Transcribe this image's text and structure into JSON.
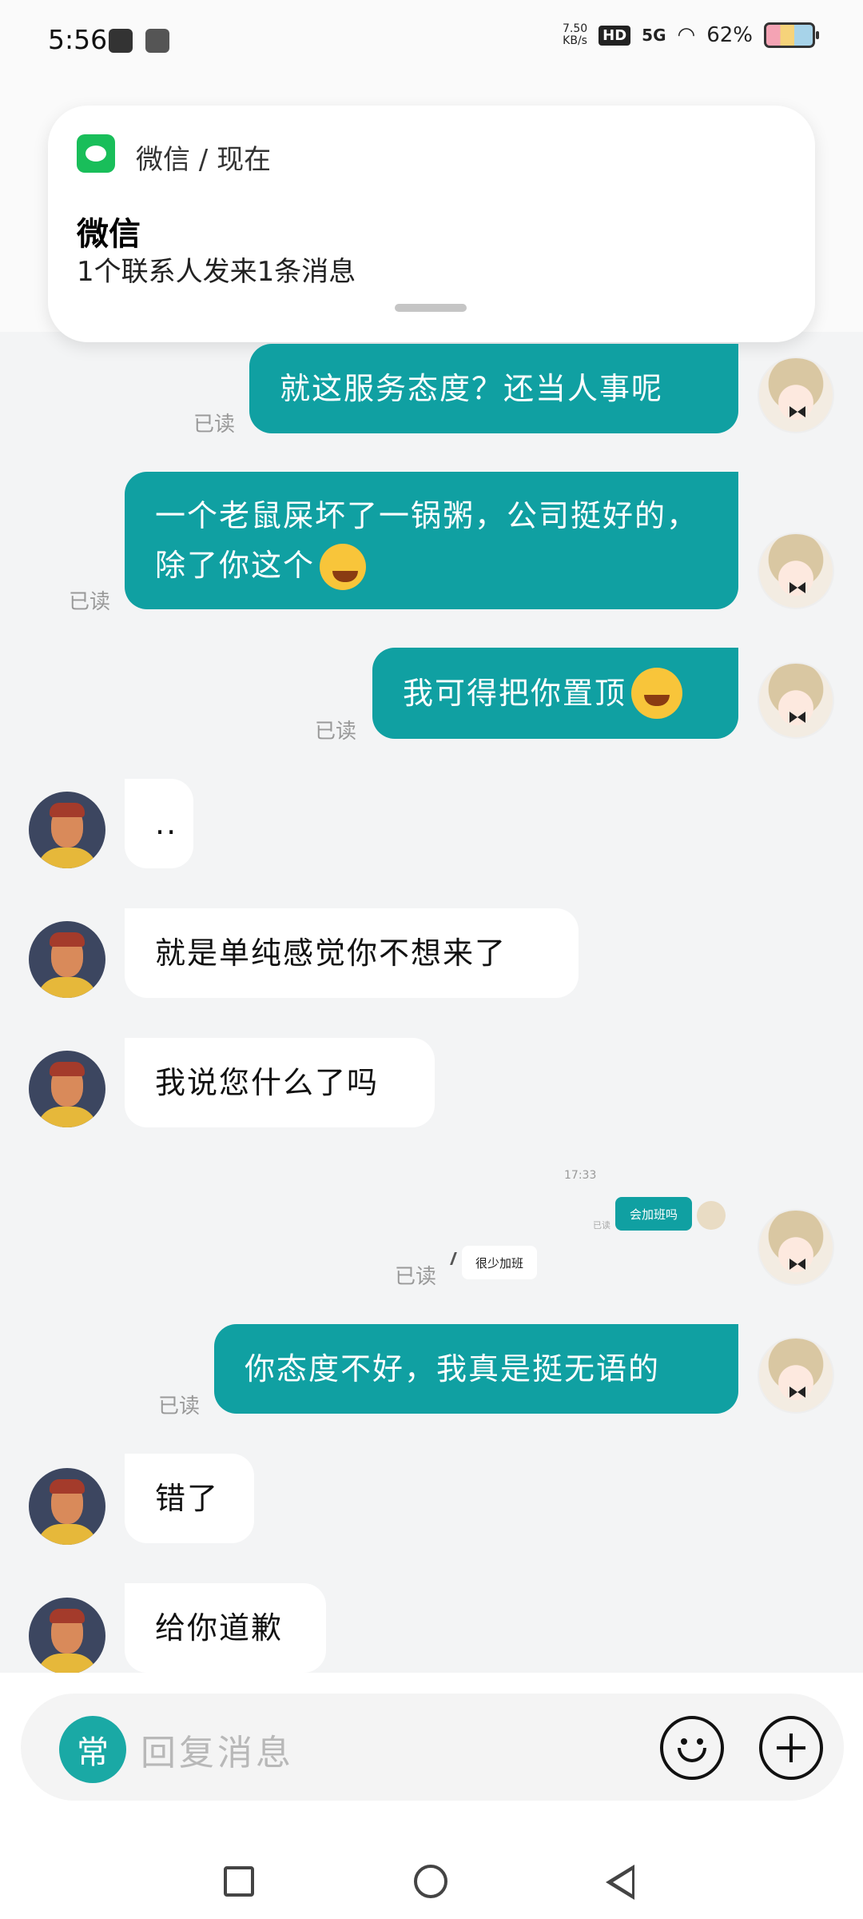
{
  "status_bar": {
    "time": "5:56",
    "net_speed_value": "7.50",
    "net_speed_unit": "KB/s",
    "hd": "HD",
    "signal": "5G",
    "battery": "62%"
  },
  "notification": {
    "app_line": "微信 / 现在",
    "title": "微信",
    "body": "1个联系人发来1条消息"
  },
  "messages": [
    {
      "side": "me",
      "text": "就这服务态度？还当人事呢",
      "read": "已读"
    },
    {
      "side": "me",
      "text": "一个老鼠屎坏了一锅粥，公司挺好的，除了你这个",
      "read": "已读",
      "emoji": "crying-laughing-emoji"
    },
    {
      "side": "me",
      "text": "我可得把你置顶",
      "read": "已读",
      "emoji": "grinning-emoji"
    },
    {
      "side": "them",
      "text": ".."
    },
    {
      "side": "them",
      "text": "就是单纯感觉你不想来了"
    },
    {
      "side": "them",
      "text": "我说您什么了吗"
    },
    {
      "side": "me",
      "type": "image",
      "read": "已读",
      "inner_time": "17:33",
      "inner_mine": "会加班吗",
      "inner_read": "已读",
      "inner_theirs": "很少加班"
    },
    {
      "side": "me",
      "text": "你态度不好，我真是挺无语的",
      "read": "已读"
    },
    {
      "side": "them",
      "text": "错了"
    },
    {
      "side": "them",
      "text": "给你道歉"
    }
  ],
  "input": {
    "quick_label": "常",
    "placeholder": "回复消息"
  },
  "colors": {
    "my_bubble": "#10a0a2",
    "their_bubble": "#ffffff",
    "background": "#f3f4f5"
  }
}
